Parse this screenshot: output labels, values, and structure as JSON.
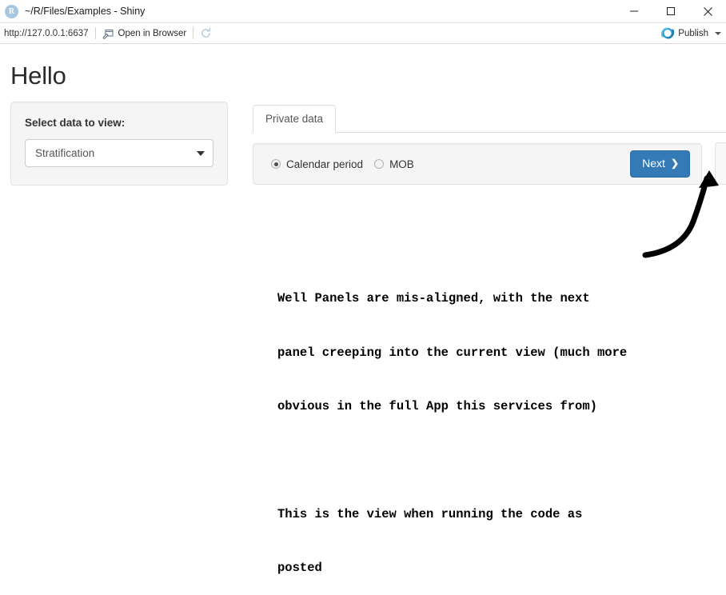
{
  "titlebar": {
    "app_icon": "r-logo-icon",
    "title": "~/R/Files/Examples - Shiny",
    "minimize": "minimize-icon",
    "maximize": "maximize-icon",
    "close": "close-icon"
  },
  "toolbar": {
    "url": "http://127.0.0.1:6637",
    "open_in_browser_label": "Open in Browser",
    "open_in_browser_icon": "external-window-icon",
    "refresh_icon": "refresh-icon",
    "publish_label": "Publish",
    "publish_icon": "publish-icon",
    "publish_caret": "chevron-down-icon"
  },
  "app": {
    "page_title": "Hello",
    "sidebar": {
      "label": "Select data to view:",
      "select_value": "Stratification",
      "select_caret": "caret-down-icon"
    },
    "main": {
      "tabs": [
        {
          "label": "Private data",
          "active": true
        }
      ],
      "well": {
        "radios": [
          {
            "label": "Calendar period",
            "selected": true
          },
          {
            "label": "MOB",
            "selected": false
          }
        ],
        "next_button": {
          "label": "Next",
          "icon": "chevron-right-icon"
        }
      }
    }
  },
  "annotation": {
    "arrow": "curved-arrow-up-right",
    "paragraph1_line1": "Well Panels are mis-aligned, with the next",
    "paragraph1_line2": "panel creeping into the current view (much more",
    "paragraph1_line3": "obvious in the full App this services from)",
    "paragraph2_line1": "This is the view when running the code as",
    "paragraph2_line2": "posted"
  },
  "colors": {
    "accent_blue": "#337ab7",
    "panel_grey": "#f5f5f5",
    "border_grey": "#e3e3e3",
    "publish_blue": "#2196d6"
  }
}
